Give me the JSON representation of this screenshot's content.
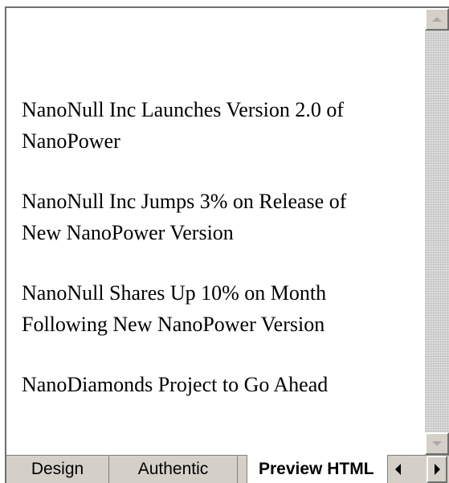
{
  "preview": {
    "headlines": [
      {
        "line1": "NanoNull Inc Launches Version 2.0 of",
        "line2": "NanoPower"
      },
      {
        "line1": "NanoNull Inc Jumps 3% on Release of",
        "line2": "New NanoPower Version"
      },
      {
        "line1": "NanoNull Shares Up 10% on Month",
        "line2": "Following New NanoPower Version"
      },
      {
        "line1": "NanoDiamonds Project to Go Ahead",
        "line2": ""
      }
    ]
  },
  "tabs": {
    "design": "Design",
    "authentic": "Authentic",
    "preview_html": "Preview HTML",
    "active": "preview_html"
  },
  "icons": {
    "scroll_up": "scroll-up-arrow-icon",
    "scroll_down": "scroll-down-arrow-icon",
    "tab_left": "tab-scroll-left-icon",
    "tab_right": "tab-scroll-right-icon"
  }
}
